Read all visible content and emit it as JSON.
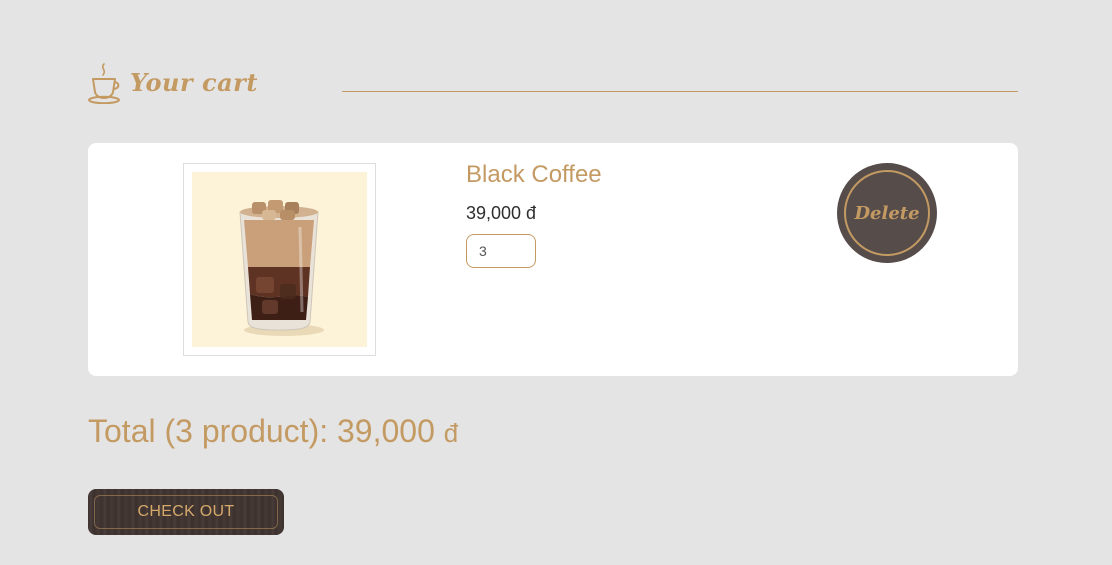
{
  "header": {
    "title": "Your cart",
    "icon": "coffee-cup-icon"
  },
  "cart": {
    "items": [
      {
        "name": "Black Coffee",
        "price": "39,000 đ",
        "quantity": "3",
        "image": "iced-coffee-glass",
        "delete_label": "Delete"
      }
    ]
  },
  "summary": {
    "total_label": "Total (3 product): 39,000",
    "currency": "đ"
  },
  "actions": {
    "checkout_label": "CHECK OUT"
  },
  "colors": {
    "background": "#e4e4e4",
    "accent": "#c49a63",
    "dark": "#564d4b",
    "card": "#ffffff"
  }
}
